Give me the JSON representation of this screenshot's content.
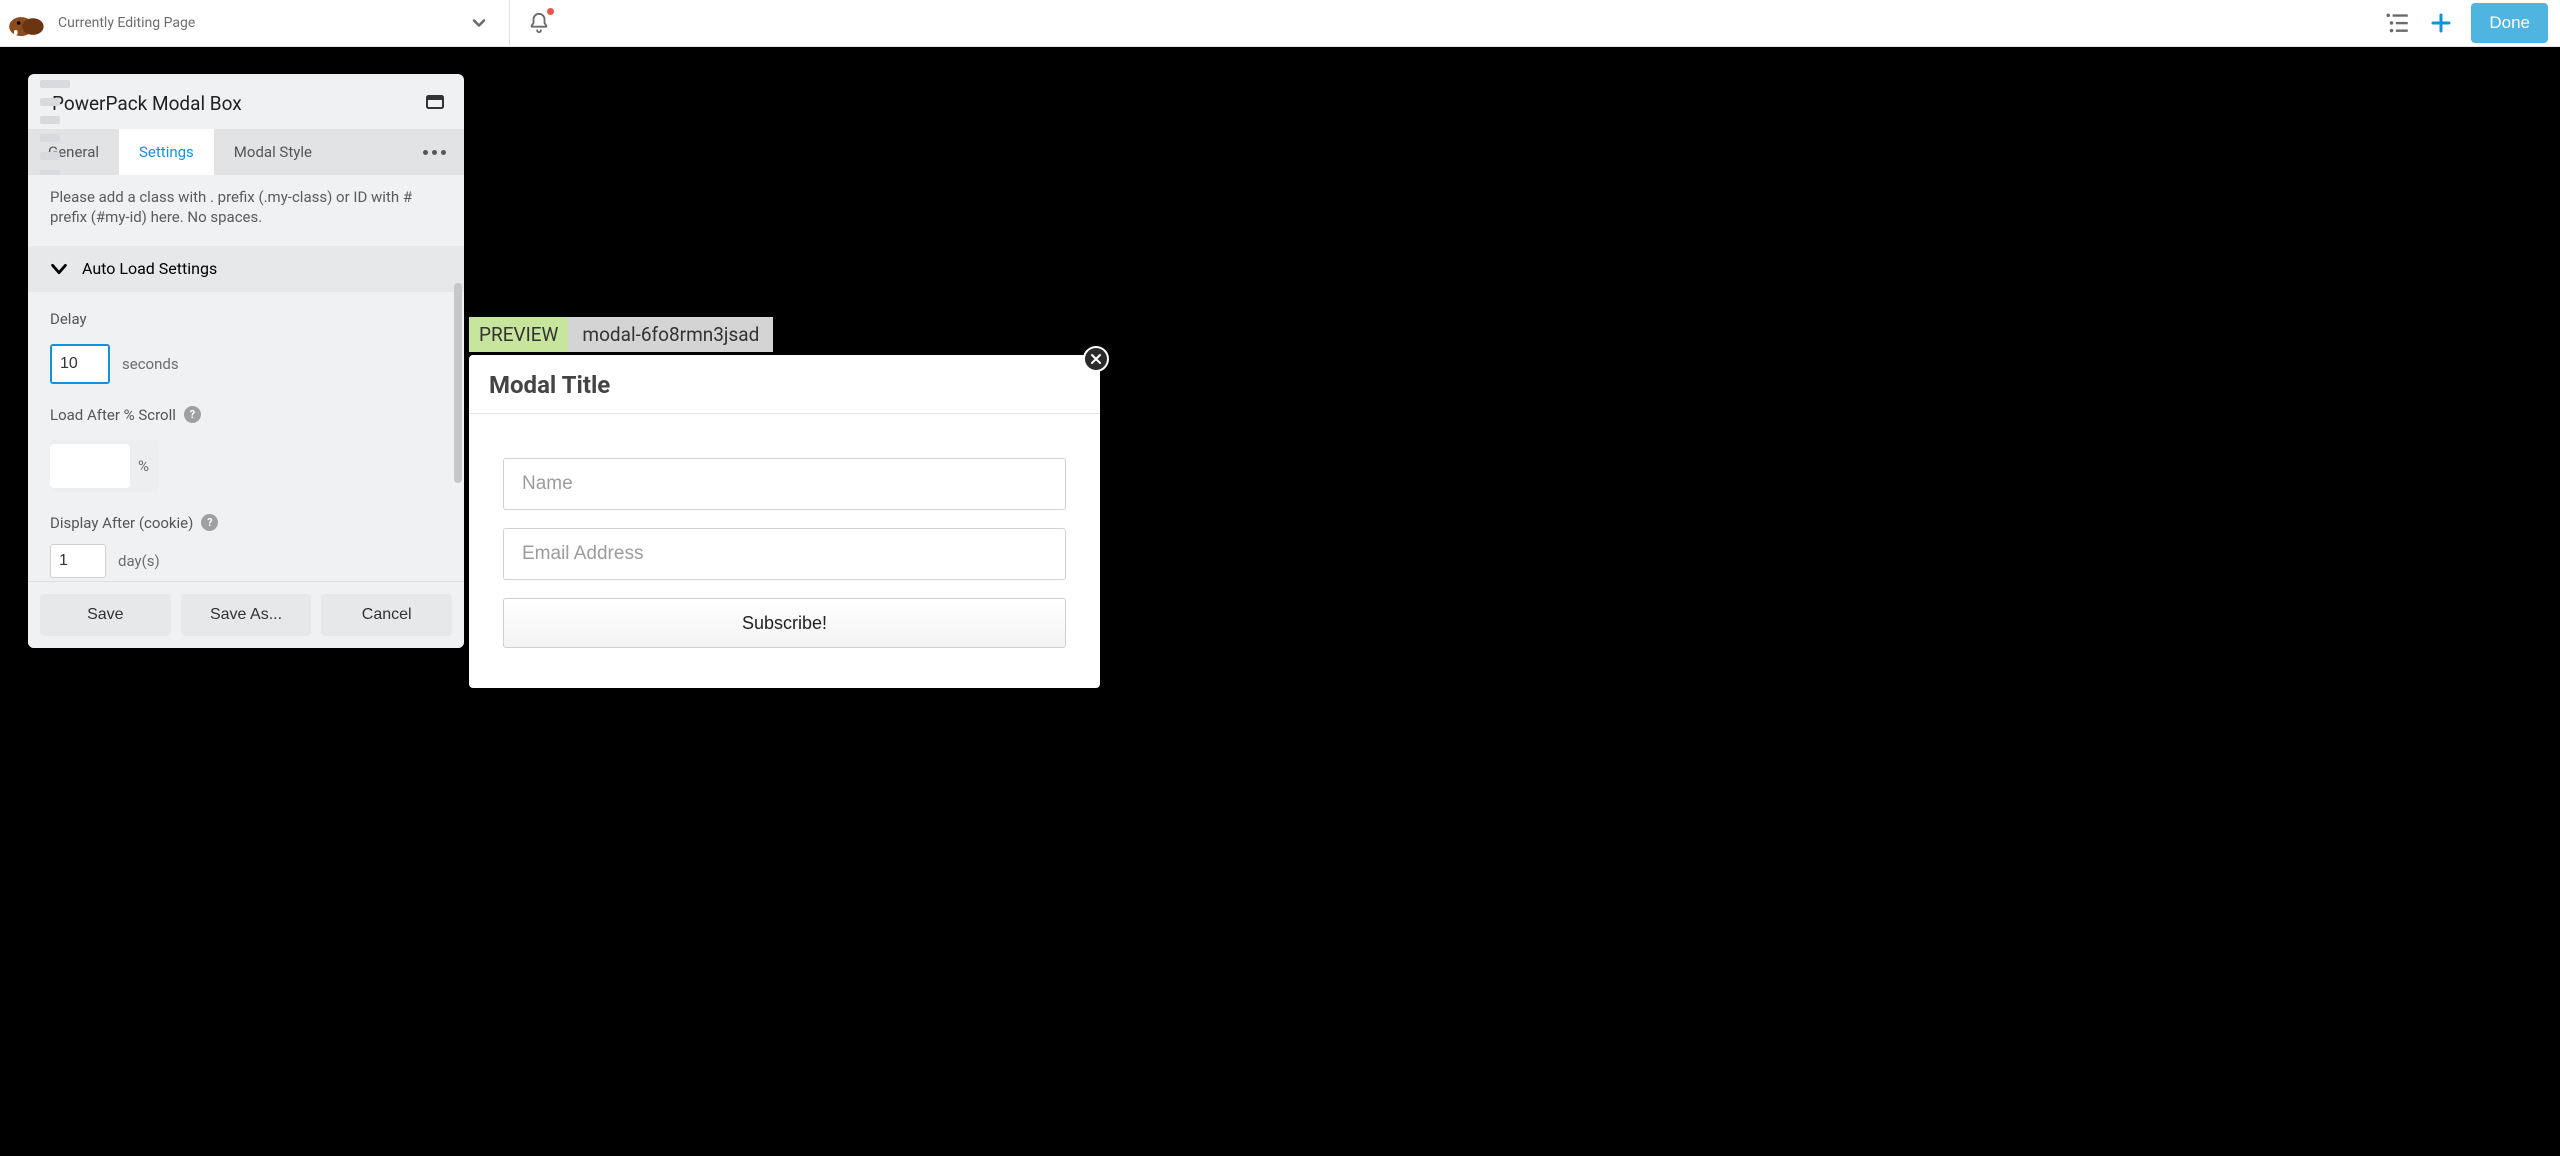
{
  "topbar": {
    "page_title": "Currently Editing Page",
    "done_label": "Done"
  },
  "panel": {
    "title": "PowerPack Modal Box",
    "tabs": {
      "general": "General",
      "settings": "Settings",
      "modal_style": "Modal Style"
    },
    "hint_text": "Please add a class with . prefix (.my-class) or ID with # prefix (#my-id) here. No spaces.",
    "section_autoload": "Auto Load Settings",
    "delay": {
      "label": "Delay",
      "value": "10",
      "unit": "seconds"
    },
    "scroll": {
      "label": "Load After % Scroll",
      "value": "",
      "unit": "%"
    },
    "cookie": {
      "label": "Display After (cookie)",
      "value": "1",
      "unit": "day(s)"
    },
    "footer": {
      "save": "Save",
      "save_as": "Save As...",
      "cancel": "Cancel"
    }
  },
  "preview": {
    "badge": "PREVIEW",
    "id": "modal-6fo8rmn3jsad"
  },
  "modal": {
    "title": "Modal Title",
    "name_placeholder": "Name",
    "email_placeholder": "Email Address",
    "subscribe_label": "Subscribe!"
  }
}
